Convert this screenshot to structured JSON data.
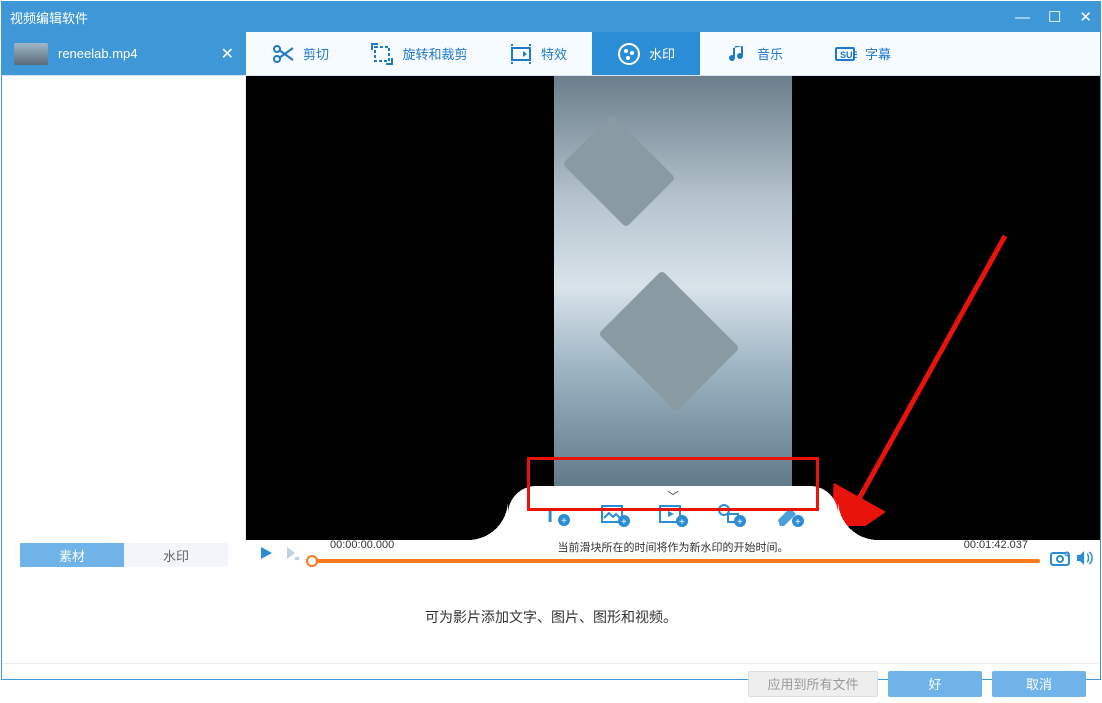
{
  "window": {
    "title": "视频编辑软件",
    "min": "—",
    "max": "☐",
    "close": "✕"
  },
  "file_tab": {
    "name": "reneelab.mp4",
    "close": "✕"
  },
  "toolbar": {
    "cut": "剪切",
    "rotate": "旋转和裁剪",
    "effect": "特效",
    "watermark": "水印",
    "music": "音乐",
    "subtitle": "字幕"
  },
  "side_tabs": {
    "material": "素材",
    "watermark": "水印"
  },
  "timeline": {
    "start": "00:00:00.000",
    "end": "00:01:42.037",
    "hint": "当前滑块所在的时间将作为新水印的开始时间。"
  },
  "info": {
    "text": "可为影片添加文字、图片、图形和视频。"
  },
  "bottom": {
    "apply_all": "应用到所有文件",
    "ok": "好",
    "cancel": "取消"
  },
  "wm_buttons": {
    "chev": "﹀",
    "text": "add-text-icon",
    "image": "add-image-icon",
    "video": "add-video-icon",
    "shape": "add-shape-icon",
    "erase": "add-erase-icon"
  }
}
